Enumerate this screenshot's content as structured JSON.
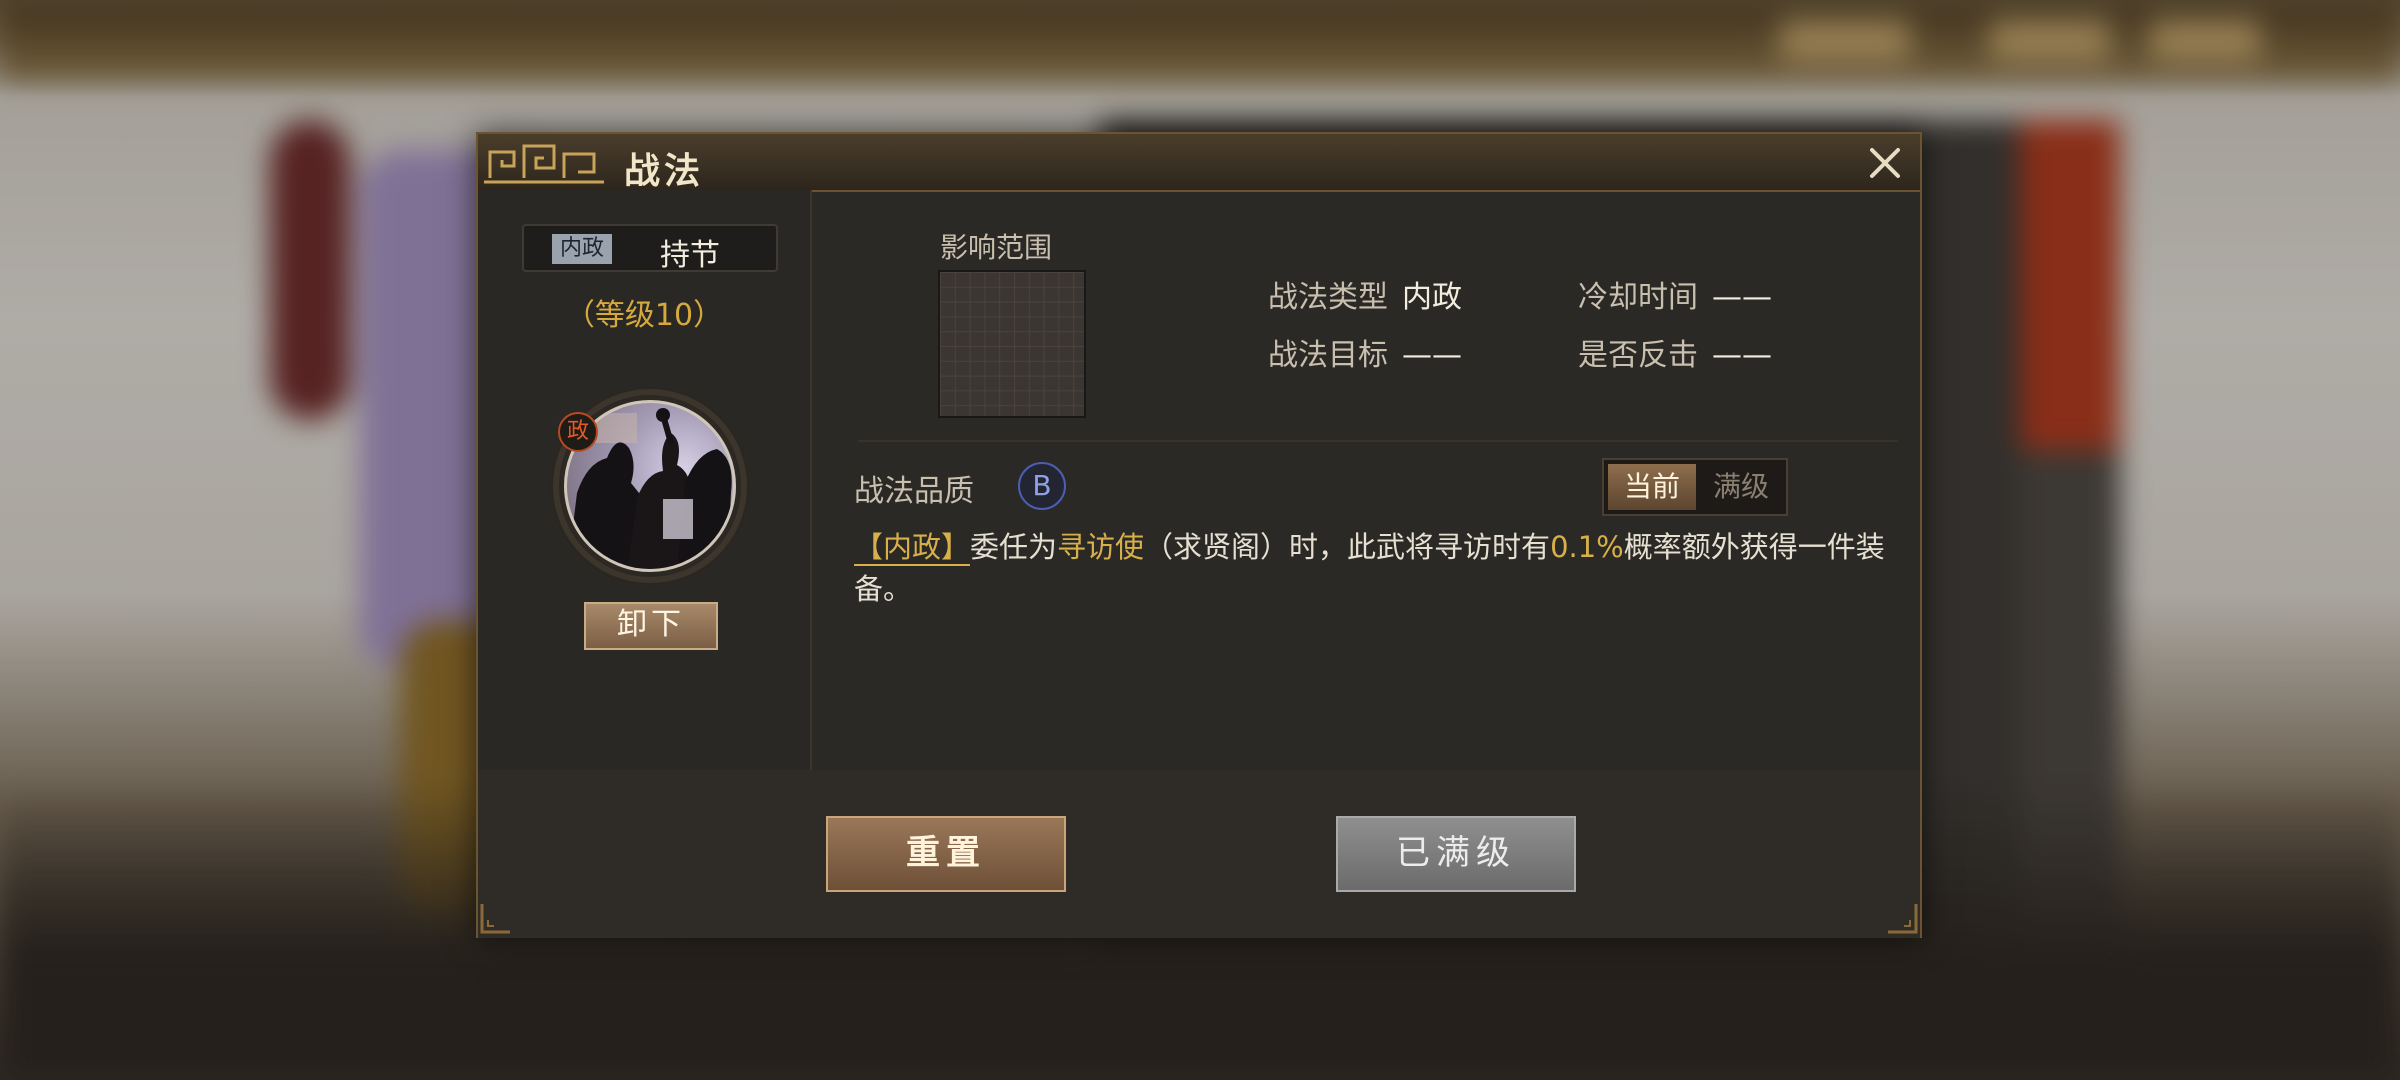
{
  "dialog": {
    "title": "战法",
    "close_icon": "close-icon"
  },
  "skill": {
    "type_tag": "内政",
    "name": "持节",
    "level": "（等级10）",
    "portrait_badge": "政",
    "unequip_label": "卸下"
  },
  "range": {
    "label": "影响范围"
  },
  "attributes": {
    "type_key": "战法类型",
    "type_value": "内政",
    "cooldown_key": "冷却时间",
    "cooldown_value": "——",
    "target_key": "战法目标",
    "target_value": "——",
    "counter_key": "是否反击",
    "counter_value": "——"
  },
  "quality": {
    "label": "战法品质",
    "grade": "B",
    "toggle_current": "当前",
    "toggle_max": "满级"
  },
  "description": {
    "tag": "【内政】",
    "part1": "委任为",
    "hl1": "寻访使",
    "part2": "（求贤阁）时，此武将寻访时有",
    "hl2": "0.1%",
    "part3": "概率额外获得一件装备。"
  },
  "footer": {
    "reset_label": "重置",
    "maxed_label": "已满级"
  },
  "colors": {
    "accent_gold": "#d8b04a",
    "frame_bronze": "#6b5530",
    "quality_blue": "#4a5fb2"
  }
}
